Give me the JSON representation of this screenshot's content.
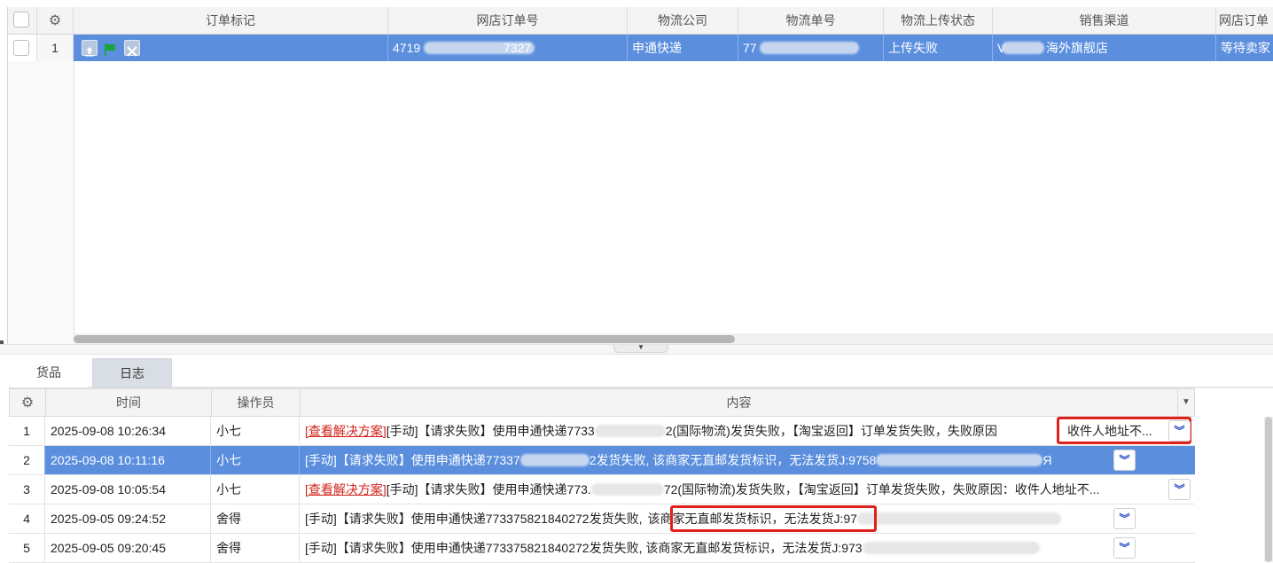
{
  "top_grid": {
    "columns": [
      "订单标记",
      "网店订单号",
      "物流公司",
      "物流单号",
      "物流上传状态",
      "销售渠道",
      "网店订单"
    ],
    "row": {
      "index": "1",
      "order_no": "4719",
      "order_no_tail": "7327",
      "logistics_company": "申通快递",
      "tracking_no": "77",
      "upload_status": "上传失败",
      "channel_prefix": "V",
      "channel": "海外旗舰店",
      "shop_status": "等待卖家"
    }
  },
  "tabs": [
    "货品",
    "日志"
  ],
  "log_grid": {
    "columns": [
      "时间",
      "操作员",
      "内容"
    ],
    "rows": [
      {
        "index": "1",
        "time": "2025-09-08 10:26:34",
        "operator": "小七",
        "link": "[查看解决方案]",
        "content_a": "[手动]【请求失败】使用申通快递7733",
        "content_b": "2(国际物流)发货失败，【淘宝返回】订单发货失败，失败原因",
        "highlight": "收件人地址不..."
      },
      {
        "index": "2",
        "time": "2025-09-08 10:11:16",
        "operator": "小七",
        "link": "",
        "content_a": "[手动]【请求失败】使用申通快递77337",
        "content_b": "2发货失败, 该商家无直邮发货标识，无法发货J:9758",
        "highlight": "Я"
      },
      {
        "index": "3",
        "time": "2025-09-08 10:05:54",
        "operator": "小七",
        "link": "[查看解决方案]",
        "content_a": "[手动]【请求失败】使用申通快递773.",
        "content_b": "72(国际物流)发货失败，【淘宝返回】订单发货失败，失败原因：收件人地址不...",
        "highlight": ""
      },
      {
        "index": "4",
        "time": "2025-09-05 09:24:52",
        "operator": "舍得",
        "link": "",
        "content_a": "[手动]【请求失败】使用申通快递773375821840272发货失败,",
        "content_b": "该商家无直邮发货标识，无法发货",
        "highlight": "J:97"
      },
      {
        "index": "5",
        "time": "2025-09-05 09:20:45",
        "operator": "舍得",
        "link": "",
        "content_a": "[手动]【请求失败】使用申通快递773375821840272发货失败, 该商家无直邮发货标识，无法发货J:973",
        "content_b": "",
        "highlight": ""
      }
    ]
  },
  "colors": {
    "selection": "#5b8fde",
    "link_red": "#d0231b",
    "highlight_border": "#e0201b",
    "flag_green": "#1aa53a"
  },
  "icons": [
    "gear-icon",
    "upload-mark-icon",
    "green-flag-icon",
    "invalid-mark-icon",
    "expand-down-icon",
    "dropdown-arrow-icon"
  ]
}
